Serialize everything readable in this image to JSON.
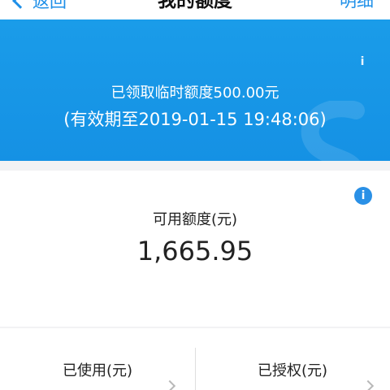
{
  "nav": {
    "back_label": "返回",
    "title": "我的额度",
    "right_label": "明细"
  },
  "banner": {
    "line1": "已领取临时额度500.00元",
    "line2": "(有效期至2019-01-15 19:48:06)",
    "info_glyph": "i",
    "background_color": "#1591e4"
  },
  "available": {
    "label": "可用额度(元)",
    "amount": "1,665.95",
    "info_glyph": "i"
  },
  "bottom": {
    "used_label": "已使用(元)",
    "authorized_label": "已授权(元)"
  },
  "colors": {
    "accent": "#1e8fe8",
    "text": "#222222",
    "page_bg": "#f2f2f4"
  },
  "icons": {
    "back": "chevron-left-icon",
    "banner_info": "info-icon",
    "card_info": "info-circle-icon",
    "cell_arrow": "chevron-right-icon"
  }
}
